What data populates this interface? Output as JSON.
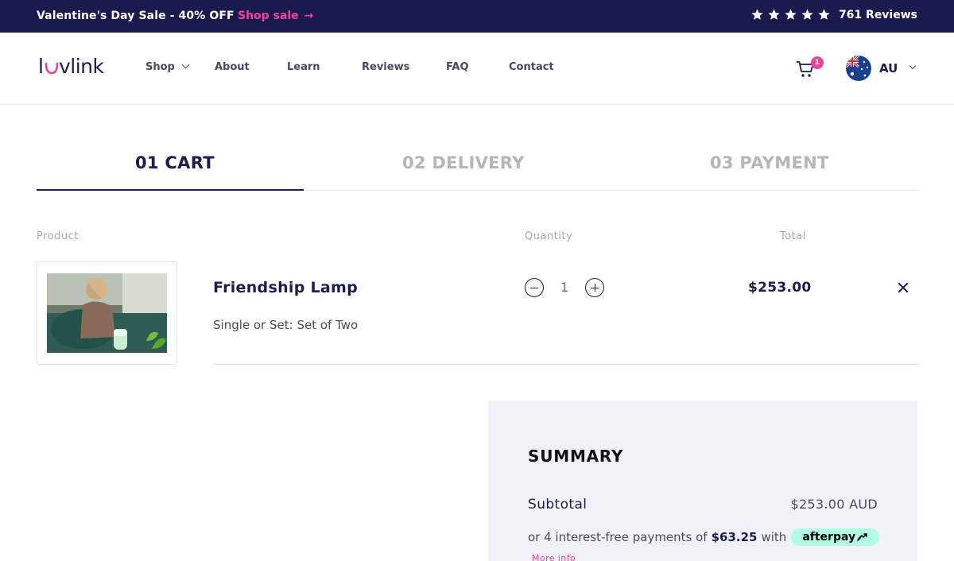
{
  "promo": {
    "text": "Valentine's Day Sale - 40% OFF",
    "link_label": "Shop sale",
    "link_arrow": "→",
    "reviews": "761 Reviews",
    "stars": 5
  },
  "header": {
    "logo": "luvlink",
    "nav": [
      {
        "label": "Shop"
      },
      {
        "label": "About"
      },
      {
        "label": "Learn"
      },
      {
        "label": "Reviews"
      },
      {
        "label": "FAQ"
      },
      {
        "label": "Contact"
      }
    ],
    "cart_count": "1",
    "country": "AU"
  },
  "steps": [
    {
      "label": "01 CART",
      "active": true
    },
    {
      "label": "02 DELIVERY",
      "active": false
    },
    {
      "label": "03 PAYMENT",
      "active": false
    }
  ],
  "table_headers": {
    "product": "Product",
    "quantity": "Quantity",
    "total": "Total"
  },
  "cart_items": [
    {
      "name": "Friendship Lamp",
      "variant": "Single or Set: Set of Two",
      "quantity": "1",
      "total": "$253.00"
    }
  ],
  "summary": {
    "title": "SUMMARY",
    "subtotal_label": "Subtotal",
    "subtotal_value": "$253.00 AUD",
    "afterpay_prefix": "or 4 interest-free payments of",
    "afterpay_amount": "$63.25",
    "afterpay_with": "with",
    "afterpay_brand": "afterpay",
    "more_info": "More info"
  },
  "colors": {
    "navy": "#1b1a4f",
    "pink": "#e84594",
    "afterpay_mint": "#b2fce4",
    "summary_bg": "#f1f2f8"
  }
}
